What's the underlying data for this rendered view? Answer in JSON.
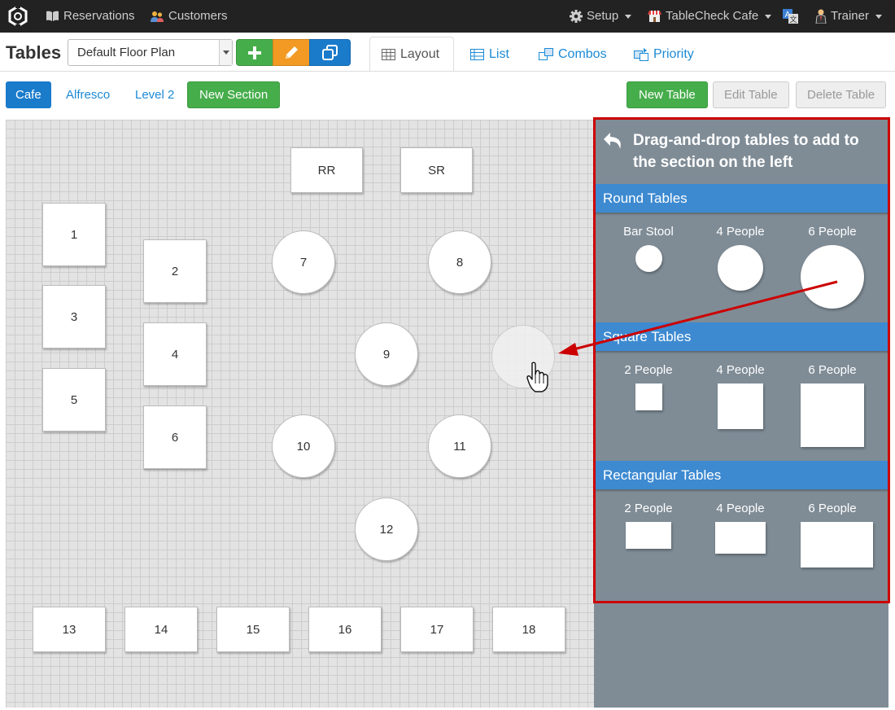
{
  "nav": {
    "reservations": "Reservations",
    "customers": "Customers",
    "setup": "Setup",
    "venue": "TableCheck Cafe",
    "user": "Trainer"
  },
  "header": {
    "title": "Tables",
    "floor_plan": "Default Floor Plan",
    "tabs": [
      "Layout",
      "List",
      "Combos",
      "Priority"
    ],
    "active_tab": "Layout"
  },
  "sections": {
    "items": [
      "Cafe",
      "Alfresco",
      "Level 2"
    ],
    "active": "Cafe",
    "new_section": "New Section"
  },
  "table_actions": {
    "new_table": "New Table",
    "edit_table": "Edit Table",
    "delete_table": "Delete Table"
  },
  "floor_tables": [
    "RR",
    "SR",
    "1",
    "2",
    "3",
    "4",
    "5",
    "6",
    "7",
    "8",
    "9",
    "10",
    "11",
    "12",
    "13",
    "14",
    "15",
    "16",
    "17",
    "18"
  ],
  "panel": {
    "heading": "Drag-and-drop tables to add to the section on the left",
    "categories": [
      {
        "title": "Round Tables",
        "options": [
          "Bar Stool",
          "4 People",
          "6 People"
        ]
      },
      {
        "title": "Square Tables",
        "options": [
          "2 People",
          "4 People",
          "6 People"
        ]
      },
      {
        "title": "Rectangular Tables",
        "options": [
          "2 People",
          "4 People",
          "6 People"
        ]
      }
    ]
  },
  "colors": {
    "navbar": "#222222",
    "primary": "#1a7bcb",
    "success": "#46ad4b",
    "warning": "#f29a24",
    "panel": "#7f8c96",
    "category_header": "#3d8ad1",
    "highlight": "#cc0000"
  },
  "icons": {
    "logo": "tablecheck-logo-icon",
    "reservations": "book-icon",
    "customers": "users-icon",
    "setup": "gear-icon",
    "venue": "store-icon",
    "language": "translate-icon",
    "user": "person-icon",
    "add": "plus-icon",
    "edit": "pencil-icon",
    "copy": "copy-icon",
    "layout": "grid-icon",
    "list": "list-icon",
    "combos": "combos-icon",
    "priority": "priority-icon",
    "panel": "undo-arrow-icon",
    "cursor": "hand-pointer-icon"
  }
}
